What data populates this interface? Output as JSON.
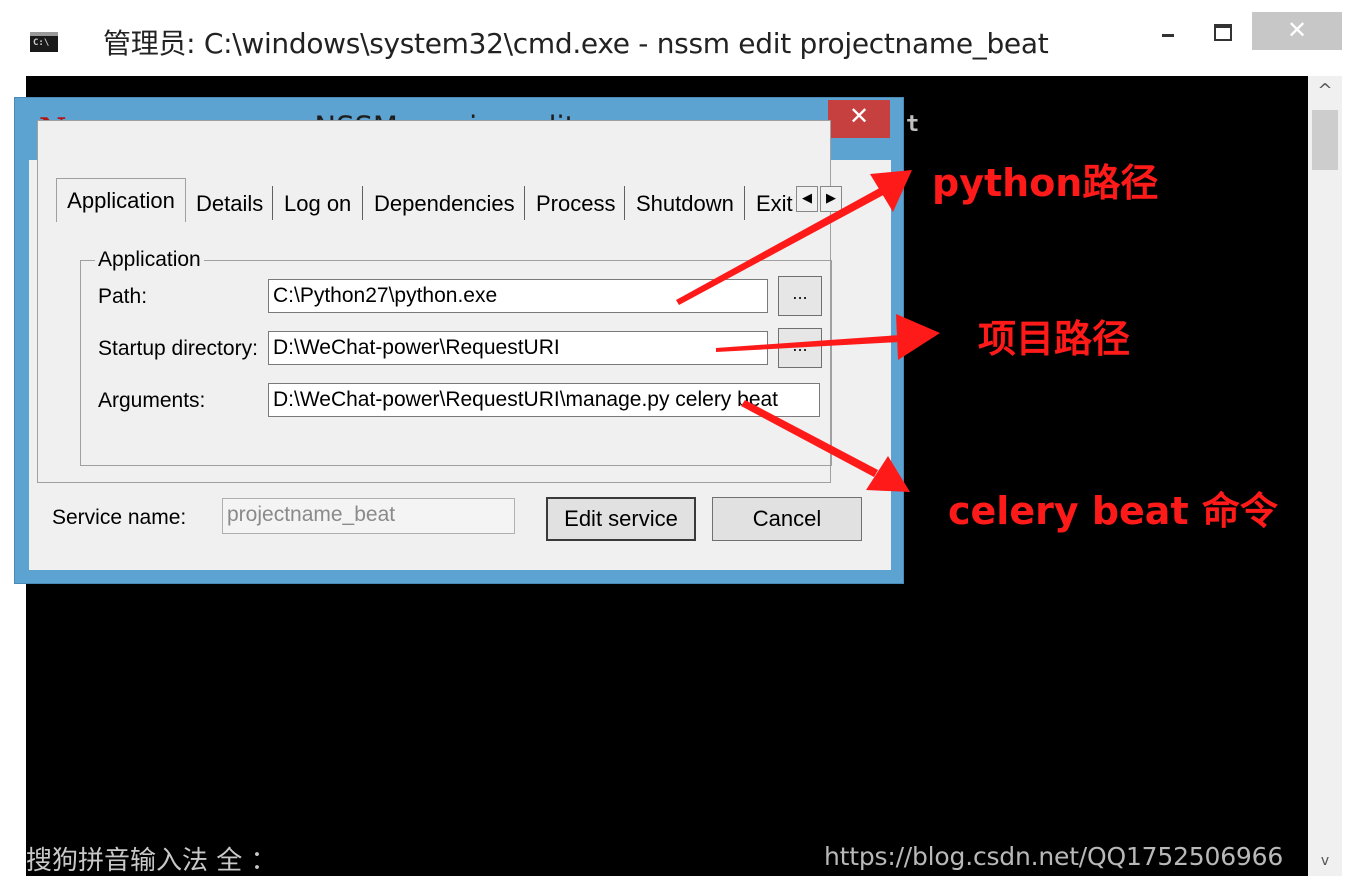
{
  "cmd_window": {
    "icon_text": "C:\\",
    "title": "管理员: C:\\windows\\system32\\cmd.exe - nssm  edit projectname_beat",
    "console_fragment": "t",
    "ime_status": "搜狗拼音输入法 全 ：",
    "watermark": "https://blog.csdn.net/QQ1752506966",
    "close_glyph": "✕"
  },
  "nssm_dialog": {
    "logo": "N",
    "title": "NSSM service editor",
    "close_glyph": "✕",
    "tabs": [
      "Application",
      "Details",
      "Log on",
      "Dependencies",
      "Process",
      "Shutdown",
      "Exit"
    ],
    "tab_scroll_left": "◀",
    "tab_scroll_right": "▶",
    "group_label": "Application",
    "fields": {
      "path": {
        "label": "Path:",
        "value": "C:\\Python27\\python.exe"
      },
      "startup_directory": {
        "label": "Startup directory:",
        "value": "D:\\WeChat-power\\RequestURI"
      },
      "arguments": {
        "label": "Arguments:",
        "value": "D:\\WeChat-power\\RequestURI\\manage.py celery beat"
      }
    },
    "browse_label": "...",
    "service_name": {
      "label": "Service name:",
      "value": "projectname_beat"
    },
    "buttons": {
      "edit": "Edit service",
      "cancel": "Cancel"
    }
  },
  "annotations": {
    "python_path": "python路径",
    "project_path": "项目路径",
    "celery_beat": "celery beat 命令",
    "color": "#ff1a1a"
  }
}
